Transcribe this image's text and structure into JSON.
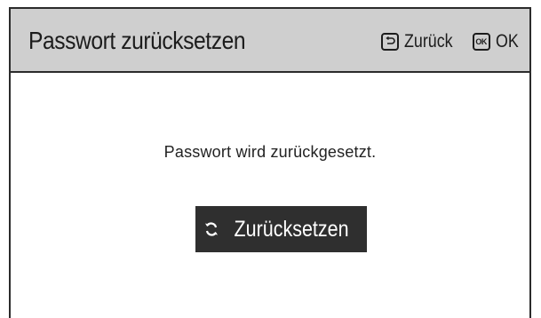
{
  "dialog": {
    "title": "Passwort zurücksetzen",
    "back_label": "Zurück",
    "back_icon": "return-arrow-icon",
    "ok_icon_text": "OK",
    "ok_label": "OK",
    "message": "Passwort wird zurückgesetzt.",
    "reset_button_label": "Zurücksetzen",
    "reset_icon": "refresh-icon",
    "colors": {
      "header_bg": "#cfcfcf",
      "button_bg": "#2f2f2f",
      "button_text": "#ffffff",
      "border": "#2b2b2b"
    }
  }
}
